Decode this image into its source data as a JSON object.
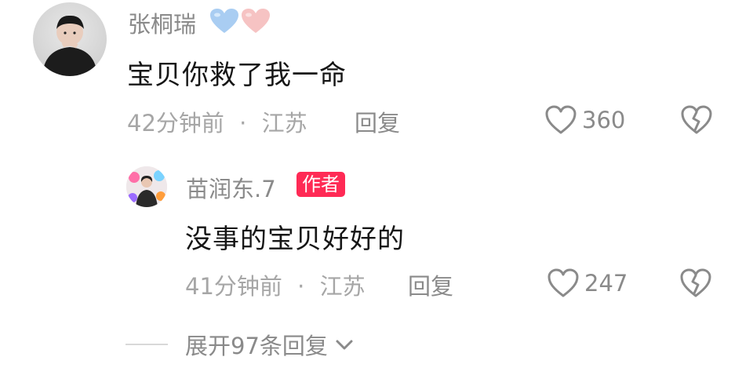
{
  "comment": {
    "username": "张桐瑞",
    "badges": [
      "light-blue-heart-icon",
      "light-pink-heart-icon"
    ],
    "text": "宝贝你救了我一命",
    "time": "42分钟前",
    "separator": "·",
    "location": "江苏",
    "reply_label": "回复",
    "likes": "360"
  },
  "reply": {
    "username": "苗润东.7",
    "author_tag": "作者",
    "text": "没事的宝贝好好的",
    "time": "41分钟前",
    "separator": "·",
    "location": "江苏",
    "reply_label": "回复",
    "likes": "247"
  },
  "expand": {
    "label": "展开97条回复"
  },
  "colors": {
    "author_tag_bg": "#ff2a55",
    "heart_blue": "#a9cdf2",
    "heart_pink": "#f6c3c3",
    "text_primary": "#161616",
    "text_secondary": "#8a8a8a",
    "text_meta": "#a6a6a6"
  }
}
